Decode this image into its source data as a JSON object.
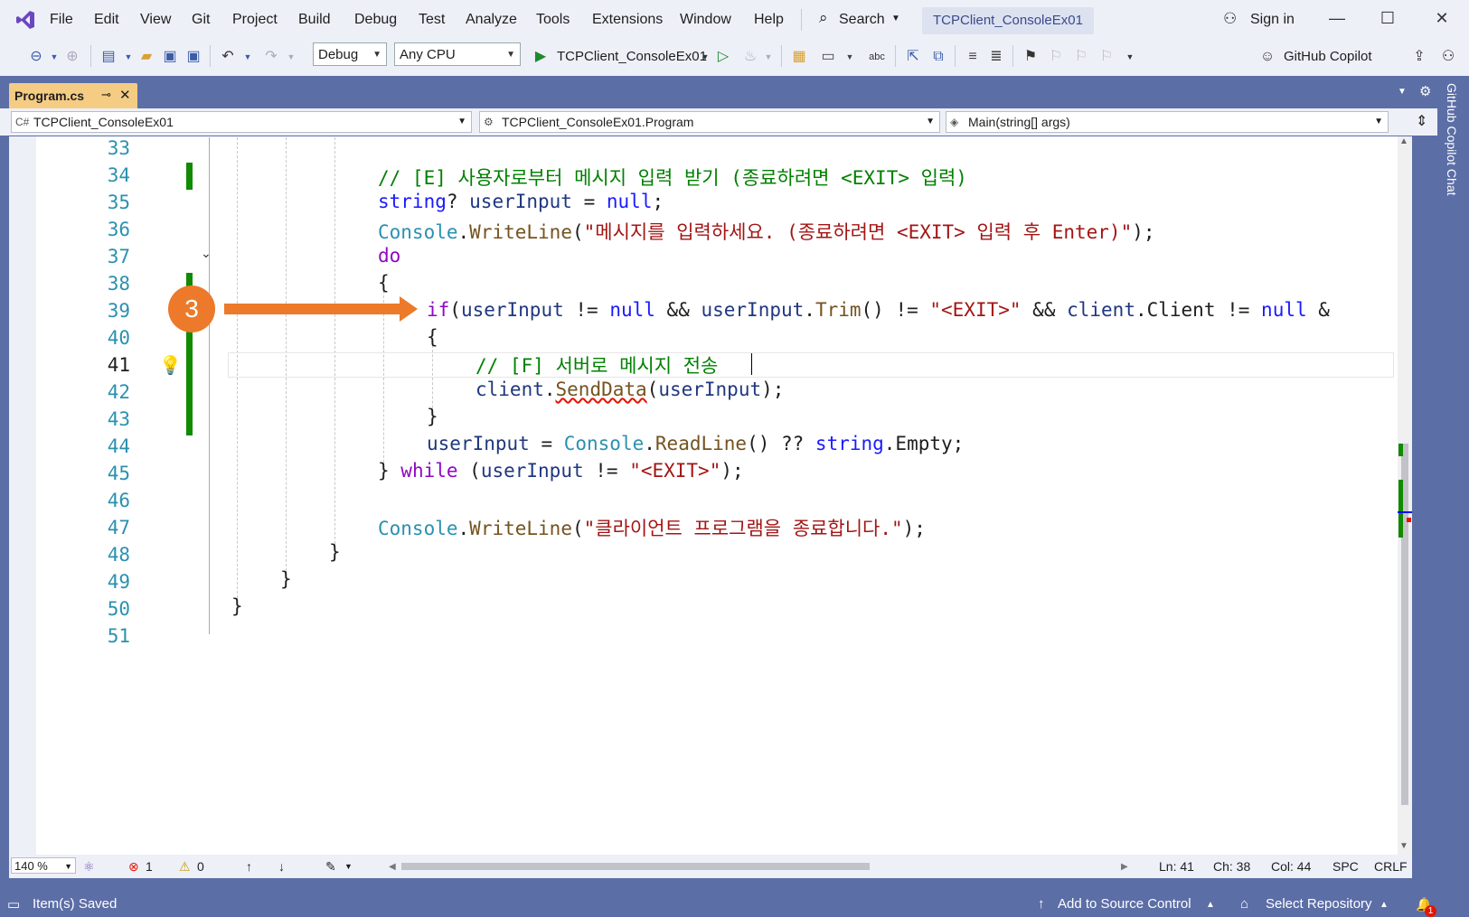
{
  "menu": {
    "items": [
      "File",
      "Edit",
      "View",
      "Git",
      "Project",
      "Build",
      "Debug",
      "Test",
      "Analyze",
      "Tools",
      "Extensions",
      "Window",
      "Help"
    ],
    "search_label": "Search",
    "solution_title": "TCPClient_ConsoleEx01",
    "sign_in": "Sign in"
  },
  "toolbar": {
    "configuration": "Debug",
    "platform": "Any CPU",
    "run_target": "TCPClient_ConsoleEx01",
    "copilot_label": "GitHub Copilot"
  },
  "tab": {
    "label": "Program.cs"
  },
  "nav": {
    "project": "TCPClient_ConsoleEx01",
    "type": "TCPClient_ConsoleEx01.Program",
    "member": "Main(string[] args)"
  },
  "editor": {
    "line_numbers": [
      "33",
      "34",
      "35",
      "36",
      "37",
      "38",
      "39",
      "40",
      "41",
      "42",
      "43",
      "44",
      "45",
      "46",
      "47",
      "48",
      "49",
      "50",
      "51"
    ],
    "current_line": "41",
    "lines": {
      "l34": "// [E] 사용자로부터 메시지 입력 받기 (종료하려면 <EXIT> 입력)",
      "l35_kw": "string",
      "l35_rest": "? ",
      "l35_var": "userInput",
      "l35_eq": " = ",
      "l35_null": "null",
      "l35_end": ";",
      "l36_ty": "Console",
      "l36_dot": ".",
      "l36_fn": "WriteLine",
      "l36_open": "(",
      "l36_str": "\"메시지를 입력하세요. (종료하려면 <EXIT> 입력 후 Enter)\"",
      "l36_end": ");",
      "l37": "do",
      "l38": "{",
      "l39_kw": "if",
      "l39_a": "(",
      "l39_v1": "userInput",
      "l39_b": " != ",
      "l39_null": "null",
      "l39_c": " && ",
      "l39_v2": "userInput",
      "l39_d": ".",
      "l39_fn": "Trim",
      "l39_e": "() != ",
      "l39_str": "\"<EXIT>\"",
      "l39_f": " && ",
      "l39_v3": "client",
      "l39_g": ".Client != ",
      "l39_null2": "null",
      "l39_h": " &",
      "l40": "{",
      "l41": "// [F] 서버로 메시지 전송",
      "l42_v": "client",
      "l42_dot": ".",
      "l42_fn": "SendData",
      "l42_a": "(",
      "l42_v2": "userInput",
      "l42_end": ");",
      "l43": "}",
      "l44_v": "userInput",
      "l44_a": " = ",
      "l44_ty": "Console",
      "l44_dot": ".",
      "l44_fn": "ReadLine",
      "l44_b": "() ?? ",
      "l44_kw": "string",
      "l44_c": ".Empty;",
      "l45_a": "} ",
      "l45_kw": "while",
      "l45_b": " (",
      "l45_v": "userInput",
      "l45_c": " != ",
      "l45_str": "\"<EXIT>\"",
      "l45_end": ");",
      "l47_ty": "Console",
      "l47_dot": ".",
      "l47_fn": "WriteLine",
      "l47_a": "(",
      "l47_str": "\"클라이언트 프로그램을 종료합니다.\"",
      "l47_end": ");",
      "l48": "}",
      "l49": "}",
      "l50": "}"
    }
  },
  "annotation": {
    "badge": "3"
  },
  "editor_status": {
    "zoom": "140 %",
    "errors": "1",
    "warnings": "0",
    "ln": "Ln: 41",
    "ch": "Ch: 38",
    "col": "Col: 44",
    "spc": "SPC",
    "crlf": "CRLF"
  },
  "statusbar": {
    "message": "Item(s) Saved",
    "source_control": "Add to Source Control",
    "repository": "Select Repository",
    "notifications": "1"
  },
  "right_rail": {
    "label": "GitHub Copilot Chat"
  },
  "colors": {
    "accent": "#5c6ea6",
    "tab_active": "#f5cc84",
    "annotation": "#ec7a2a",
    "change_bar": "#108a00"
  }
}
